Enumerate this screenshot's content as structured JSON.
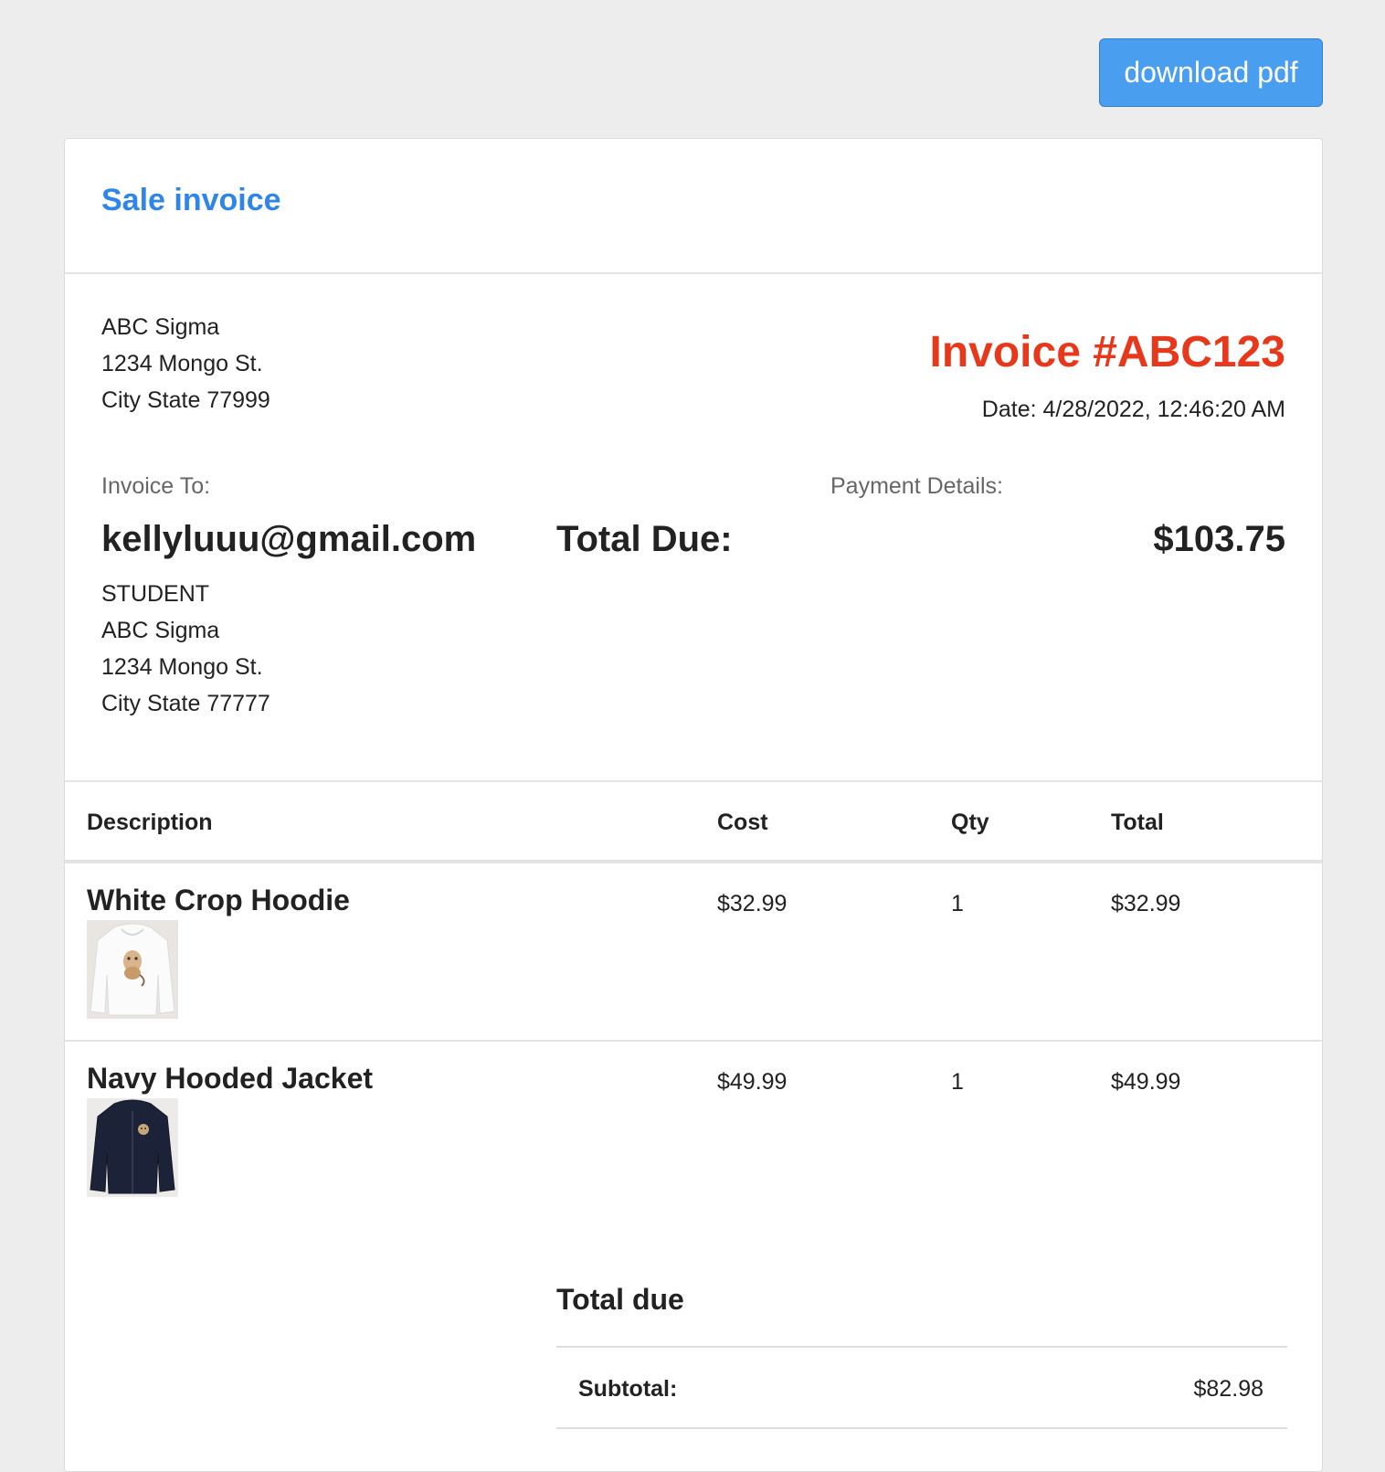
{
  "toolbar": {
    "download_label": "download pdf"
  },
  "card": {
    "title": "Sale invoice"
  },
  "seller": {
    "name": "ABC Sigma",
    "street": "1234 Mongo St.",
    "city": "City State 77999"
  },
  "invoice": {
    "number_label": "Invoice #ABC123",
    "date_label": "Date: 4/28/2022, 12:46:20 AM"
  },
  "billing": {
    "invoice_to_label": "Invoice To:",
    "email": "kellyluuu@gmail.com",
    "role": "STUDENT",
    "company": "ABC Sigma",
    "street": "1234 Mongo St.",
    "city": "City State 77777"
  },
  "payment": {
    "details_label": "Payment Details:",
    "total_due_label": "Total Due:",
    "total_due_value": "$103.75"
  },
  "table": {
    "headers": [
      "Description",
      "Cost",
      "Qty",
      "Total"
    ],
    "rows": [
      {
        "name": "White Crop Hoodie",
        "cost": "$32.99",
        "qty": "1",
        "total": "$32.99"
      },
      {
        "name": "Navy Hooded Jacket",
        "cost": "$49.99",
        "qty": "1",
        "total": "$49.99"
      }
    ]
  },
  "summary": {
    "title": "Total due",
    "subtotal_label": "Subtotal:",
    "subtotal_value": "$82.98"
  },
  "colors": {
    "accent": "#2f86e8",
    "button": "#4a9ef0",
    "invoice_number": "#e8381c",
    "page_bg": "#ededed"
  }
}
